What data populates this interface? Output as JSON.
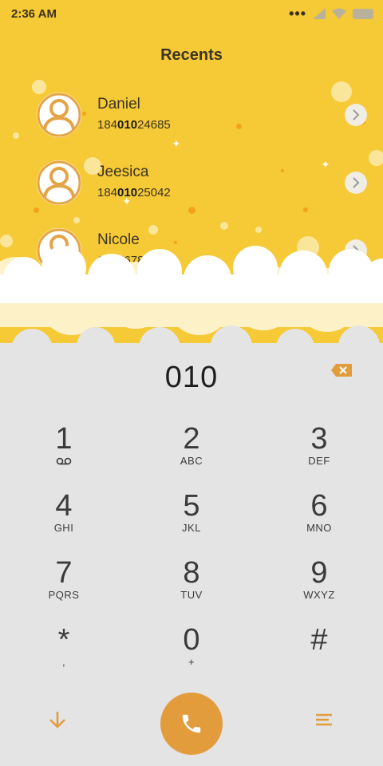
{
  "status_bar": {
    "time": "2:36 AM",
    "icons": [
      "more-dots-icon",
      "cellular-signal-icon",
      "wifi-icon",
      "battery-icon"
    ]
  },
  "recents": {
    "title": "Recents",
    "contacts": [
      {
        "name": "Daniel",
        "number_pre": "184",
        "number_match": "010",
        "number_post": "24685"
      },
      {
        "name": "Jeesica",
        "number_pre": "184",
        "number_match": "010",
        "number_post": "25042"
      },
      {
        "name": "Nicole",
        "number_pre": "1",
        "number_match": "",
        "number_post": "015678"
      }
    ]
  },
  "dialer": {
    "entered": "010",
    "keys": [
      {
        "num": "1",
        "letters": ""
      },
      {
        "num": "2",
        "letters": "ABC"
      },
      {
        "num": "3",
        "letters": "DEF"
      },
      {
        "num": "4",
        "letters": "GHI"
      },
      {
        "num": "5",
        "letters": "JKL"
      },
      {
        "num": "6",
        "letters": "MNO"
      },
      {
        "num": "7",
        "letters": "PQRS"
      },
      {
        "num": "8",
        "letters": "TUV"
      },
      {
        "num": "9",
        "letters": "WXYZ"
      },
      {
        "num": "*",
        "letters": ","
      },
      {
        "num": "0",
        "letters": "+"
      },
      {
        "num": "#",
        "letters": ""
      }
    ]
  },
  "colors": {
    "header_yellow": "#f6c936",
    "accent_orange": "#e29c3c",
    "pad_background": "#e4e4e4"
  }
}
